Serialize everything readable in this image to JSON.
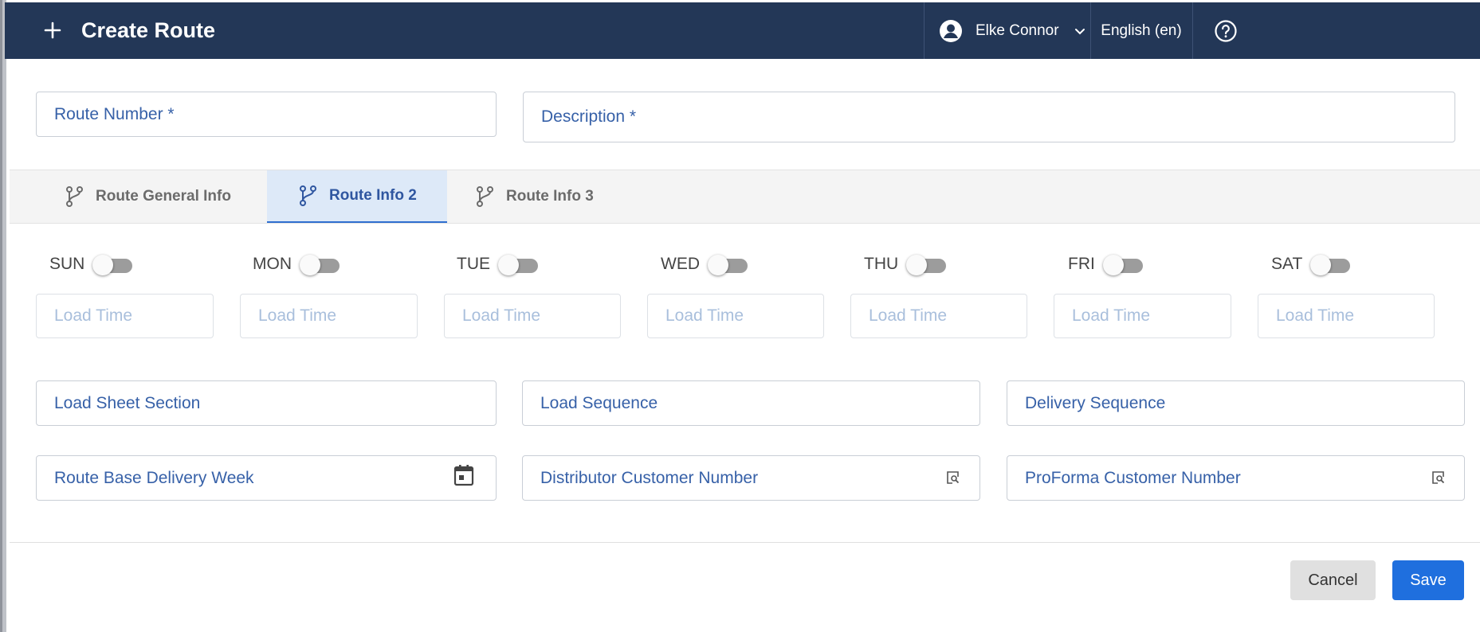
{
  "header": {
    "title": "Create Route",
    "user_name": "Elke Connor",
    "language": "English (en)"
  },
  "form": {
    "route_number_placeholder": "Route Number *",
    "description_placeholder": "Description *"
  },
  "tabs": [
    {
      "label": "Route General Info",
      "active": false
    },
    {
      "label": "Route Info 2",
      "active": true
    },
    {
      "label": "Route Info 3",
      "active": false
    }
  ],
  "days": [
    {
      "label": "SUN",
      "enabled": false,
      "load_time_placeholder": "Load Time"
    },
    {
      "label": "MON",
      "enabled": false,
      "load_time_placeholder": "Load Time"
    },
    {
      "label": "TUE",
      "enabled": false,
      "load_time_placeholder": "Load Time"
    },
    {
      "label": "WED",
      "enabled": false,
      "load_time_placeholder": "Load Time"
    },
    {
      "label": "THU",
      "enabled": false,
      "load_time_placeholder": "Load Time"
    },
    {
      "label": "FRI",
      "enabled": false,
      "load_time_placeholder": "Load Time"
    },
    {
      "label": "SAT",
      "enabled": false,
      "load_time_placeholder": "Load Time"
    }
  ],
  "fields": {
    "load_sheet_section": "Load Sheet Section",
    "load_sequence": "Load Sequence",
    "delivery_sequence": "Delivery Sequence",
    "route_base_delivery_week": "Route Base Delivery Week",
    "distributor_customer_number": "Distributor Customer Number",
    "proforma_customer_number": "ProForma Customer Number"
  },
  "footer": {
    "cancel_label": "Cancel",
    "save_label": "Save"
  },
  "colors": {
    "header_bg": "#233757",
    "accent": "#1f6fde",
    "active_tab_bg": "#dde9f8"
  },
  "icons": [
    "plus-icon",
    "user-avatar-icon",
    "chevron-down-icon",
    "help-icon",
    "branch-icon",
    "calendar-icon",
    "lookup-icon"
  ]
}
